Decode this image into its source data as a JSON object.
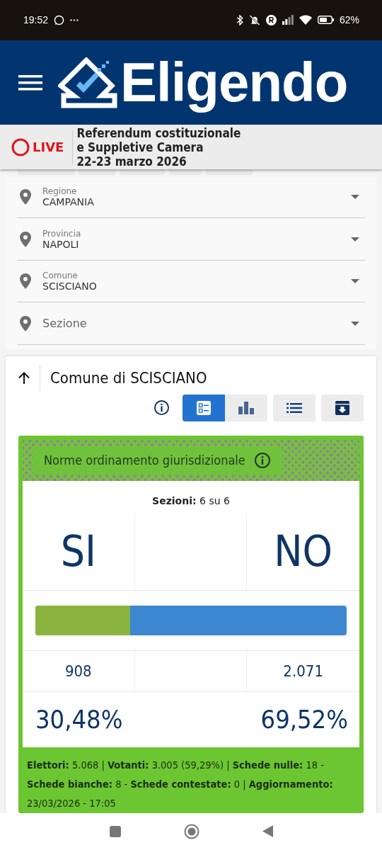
{
  "status_bar": {
    "time": "19:52",
    "battery": "62%"
  },
  "header": {
    "logo": "Eligendo"
  },
  "live_banner": {
    "badge": "LIVE",
    "title_lines": [
      "Referendum costituzionale",
      "e Suppletive Camera",
      "22-23 marzo 2026"
    ]
  },
  "hidden_tabs": [
    {
      "selected": false
    },
    {
      "selected": false
    },
    {
      "selected": false
    },
    {
      "selected": false
    },
    {
      "selected": false
    }
  ],
  "filters": [
    {
      "label": "Regione",
      "value": "CAMPANIA"
    },
    {
      "label": "Provincia",
      "value": "NAPOLI"
    },
    {
      "label": "Comune",
      "value": "SCISCIANO"
    },
    {
      "placeholder": "Sezione"
    }
  ],
  "result_card": {
    "title": "Comune di SCISCIANO",
    "views": [
      {
        "kind": "cards",
        "selected": true
      },
      {
        "kind": "chart",
        "selected": false
      },
      {
        "kind": "list",
        "selected": false
      },
      {
        "kind": "download",
        "selected": false
      }
    ],
    "question": "Norme ordinamento giurisdizionale",
    "sections": "**Sezioni:** 6 su 6",
    "options": [
      {
        "label": "SI",
        "votes": "908",
        "percent": "30,48%",
        "color": "#8ab43f"
      },
      {
        "label": "NO",
        "votes": "2.071",
        "percent": "69,52%",
        "color": "#3d87d0"
      }
    ],
    "bar": {
      "level": 0.3048
    },
    "summary": "**Elettori:** 5.068 | **Votanti:** 3.005 (59,29%) | **Schede nulle:** 18 - **Schede bianche:** 8 - **Schede contestate:** 0 | **Aggiornamento:** 23/03/2026 - 17:05"
  }
}
